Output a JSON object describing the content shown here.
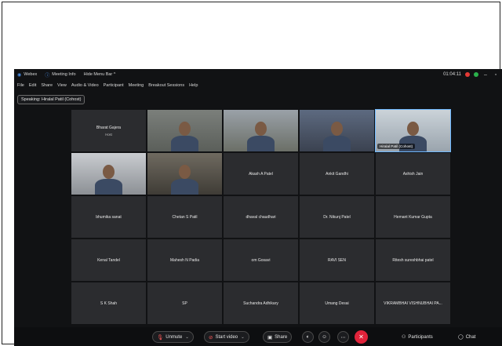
{
  "titlebar": {
    "items": [
      {
        "icon": "webex-icon",
        "label": "Webex"
      },
      {
        "icon": "info-icon",
        "label": "Meeting Info"
      },
      {
        "icon": "chevron-up-icon",
        "label": "Hide Menu Bar ^"
      }
    ],
    "time": "01:04:11"
  },
  "menubar": {
    "items": [
      "File",
      "Edit",
      "Share",
      "View",
      "Audio & Video",
      "Participant",
      "Meeting",
      "Breakout Sessions",
      "Help"
    ]
  },
  "speaking": "Speaking: Hiralal Patil (Cohost)",
  "tiles": [
    {
      "type": "name",
      "name": "Bharat Gajera",
      "sub": "Host"
    },
    {
      "type": "video",
      "variant": "v1"
    },
    {
      "type": "video",
      "variant": "v2"
    },
    {
      "type": "video",
      "variant": "v3"
    },
    {
      "type": "video",
      "variant": "v4",
      "tag": "Hiralal Patil (Cohost)",
      "active": true
    },
    {
      "type": "video",
      "variant": "v5"
    },
    {
      "type": "video",
      "variant": "v6"
    },
    {
      "type": "name",
      "name": "Akash A Patel"
    },
    {
      "type": "name",
      "name": "Ankit Gandhi"
    },
    {
      "type": "name",
      "name": "Ashish Jain"
    },
    {
      "type": "name",
      "name": "bhumika sanat"
    },
    {
      "type": "name",
      "name": "Chetan S Patil"
    },
    {
      "type": "name",
      "name": "dhaval chaudhari"
    },
    {
      "type": "name",
      "name": "Dr. Nikunj Patel"
    },
    {
      "type": "name",
      "name": "Hemant Kumar Gupta"
    },
    {
      "type": "name",
      "name": "Kenal Tandel"
    },
    {
      "type": "name",
      "name": "Mahesh N Padia"
    },
    {
      "type": "name",
      "name": "om Gosavi"
    },
    {
      "type": "name",
      "name": "RAVI SEN"
    },
    {
      "type": "name",
      "name": "Ritesh sureshbhai patel"
    },
    {
      "type": "name",
      "name": "S K Shah"
    },
    {
      "type": "name",
      "name": "SP"
    },
    {
      "type": "name",
      "name": "Suchandra Adhikary"
    },
    {
      "type": "name",
      "name": "Umang Desai"
    },
    {
      "type": "name",
      "name": "VIKRAMBHAI VISHNUBHAI PA..."
    }
  ],
  "controls": {
    "unmute_label": "Unmute",
    "start_video_label": "Start video",
    "share_label": "Share",
    "participants_label": "Participants",
    "chat_label": "Chat"
  },
  "colors": {
    "end_button": "#e0233a",
    "active_outline": "#6fb8ff",
    "app_background": "#111214",
    "tile_background": "#2b2c2f"
  }
}
